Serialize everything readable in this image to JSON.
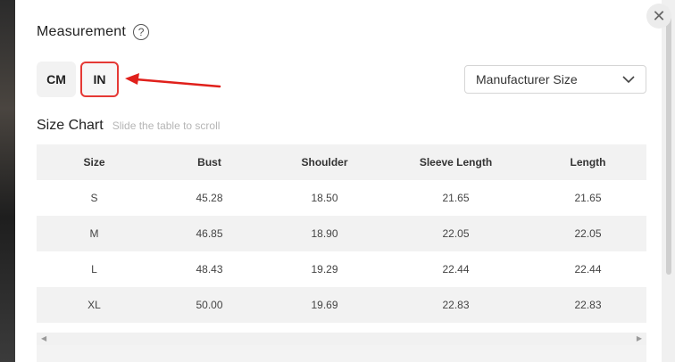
{
  "measurement": {
    "title": "Measurement",
    "help_icon": "?"
  },
  "units": {
    "cm": "CM",
    "in": "IN",
    "selected": "IN"
  },
  "size_type": {
    "value": "Manufacturer Size"
  },
  "size_chart": {
    "title": "Size Chart",
    "hint": "Slide the table to scroll",
    "columns": [
      "Size",
      "Bust",
      "Shoulder",
      "Sleeve Length",
      "Length"
    ],
    "rows": [
      [
        "S",
        "45.28",
        "18.50",
        "21.65",
        "21.65"
      ],
      [
        "M",
        "46.85",
        "18.90",
        "22.05",
        "22.05"
      ],
      [
        "L",
        "48.43",
        "19.29",
        "22.44",
        "22.44"
      ],
      [
        "XL",
        "50.00",
        "19.69",
        "22.83",
        "22.83"
      ]
    ]
  },
  "colors": {
    "highlight": "#e53935",
    "arrow": "#e0201b"
  }
}
